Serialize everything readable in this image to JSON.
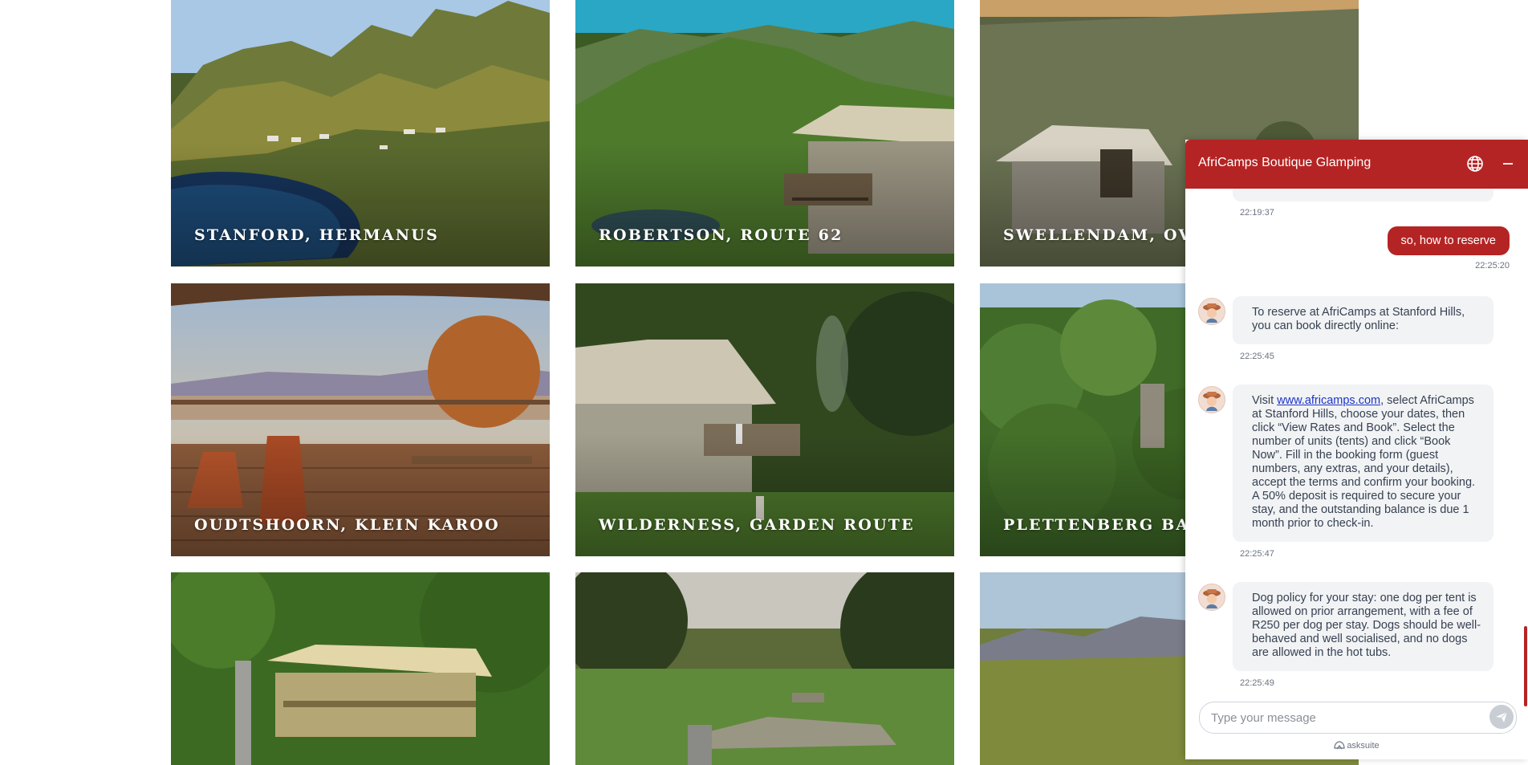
{
  "destinations": [
    {
      "label": "STANFORD, HERMANUS"
    },
    {
      "label": "ROBERTSON, ROUTE 62"
    },
    {
      "label": "SWELLENDAM, OVERBERG"
    },
    {
      "label": "OUDTSHOORN, KLEIN KAROO"
    },
    {
      "label": "WILDERNESS, GARDEN ROUTE"
    },
    {
      "label": "PLETTENBERG BAY, GARDEN ROUTE"
    },
    {
      "label": ""
    },
    {
      "label": ""
    },
    {
      "label": ""
    }
  ],
  "chat": {
    "title": "AfriCamps Boutique Glamping",
    "header_icons": [
      "globe-icon",
      "minimize-icon"
    ],
    "messages": [
      {
        "role": "bot",
        "text": "",
        "time": "22:19:37"
      },
      {
        "role": "user",
        "text": "so, how to reserve",
        "time": "22:25:20"
      },
      {
        "role": "bot",
        "text": "To reserve at AfriCamps at Stanford Hills, you can book directly online:",
        "time": "22:25:45"
      },
      {
        "role": "bot",
        "pre": "Visit ",
        "link": "www.africamps.com",
        "post": ", select AfriCamps at Stanford Hills, choose your dates, then click “View Rates and Book”. Select the number of units (tents) and click “Book Now”. Fill in the booking form (guest numbers, any extras, and your details), accept the terms and confirm your booking. A 50% deposit is required to secure your stay, and the outstanding balance is due 1 month prior to check-in.",
        "time": "22:25:47"
      },
      {
        "role": "bot",
        "text": "Dog policy for your stay: one dog per tent is allowed on prior arrangement, with a fee of R250 per dog per stay. Dogs should be well-behaved and well socialised, and no dogs are allowed in the hot tubs.",
        "time": "22:25:49"
      }
    ],
    "input": {
      "placeholder": "Type your message",
      "value": ""
    },
    "powered_by": "asksuite"
  },
  "colors": {
    "brand": "#b52424",
    "bubble_bg": "#f1f3f5",
    "link": "#1d34c8"
  }
}
